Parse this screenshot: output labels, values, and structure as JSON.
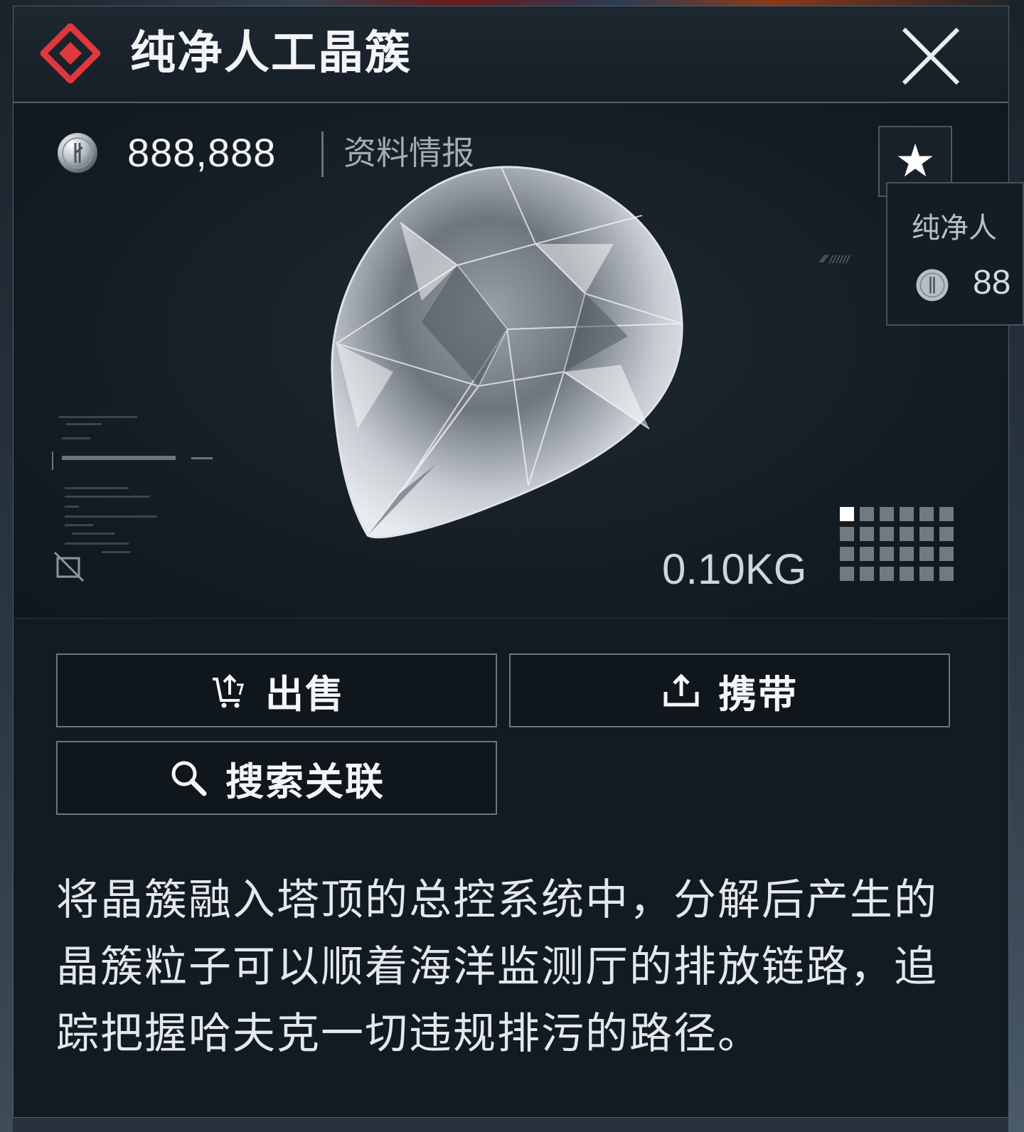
{
  "item": {
    "name": "纯净人工晶簇",
    "price": "888,888",
    "intel_label": "资料情报",
    "weight": "0.10KG",
    "description": "将晶簇融入塔顶的总控系统中，分解后产生的晶簇粒子可以顺着海洋监测厅的排放链路，追踪把握哈夫克一切违规排污的路径。",
    "rarity_color": "#e0383e"
  },
  "actions": {
    "sell_label": "出售",
    "carry_label": "携带",
    "search_label": "搜索关联"
  },
  "tooltip": {
    "title": "纯净人",
    "price": "88"
  },
  "icons": {
    "rarity": "red-diamond-rarity-icon",
    "close": "close-x-icon",
    "coin": "silver-coin-icon",
    "favorite": "star-icon",
    "no_trade": "no-trade-icon",
    "sell": "sell-cart-icon",
    "carry": "upload-tray-icon",
    "search": "magnifier-icon"
  }
}
